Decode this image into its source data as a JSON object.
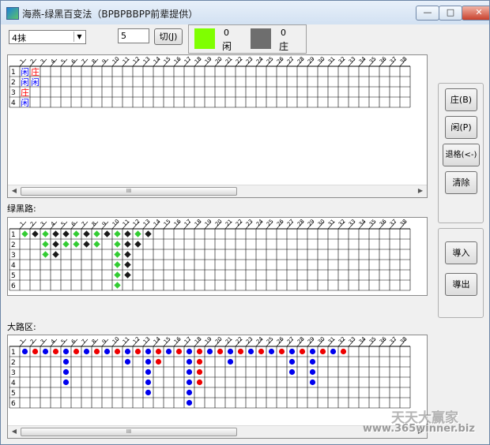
{
  "window": {
    "title": "海燕-绿黑百变法（BPBPBBPP前辈提供）",
    "buttons": {
      "minimize": "—",
      "maximize": "□",
      "close": "✕"
    }
  },
  "toolbar": {
    "pattern_select": "4抹",
    "count_value": "5",
    "cut_button": "切(J)",
    "player_count": "0",
    "player_label": "闲",
    "banker_count": "0",
    "banker_label": "庄"
  },
  "colors": {
    "player_swatch": "#7fff00",
    "banker_swatch": "#6e6e6e",
    "player_text": "#0000ff",
    "banker_text": "#ff0000",
    "green_mark": "#33cc33",
    "black_mark": "#1a1a1a",
    "blue_dot": "#0000ee",
    "red_dot": "#ee0000"
  },
  "top_grid": {
    "columns": [
      "1",
      "2",
      "3",
      "4",
      "5",
      "6",
      "7",
      "8",
      "9",
      "10",
      "11",
      "12",
      "13",
      "14",
      "15",
      "16",
      "17",
      "18",
      "19",
      "20",
      "21",
      "22",
      "23",
      "24",
      "25",
      "26",
      "27",
      "28",
      "29",
      "30",
      "31",
      "32",
      "33",
      "34",
      "35",
      "36",
      "37",
      "38"
    ],
    "rows": [
      "1",
      "2",
      "3",
      "4"
    ],
    "cells": [
      {
        "row": 0,
        "col": 0,
        "text": "闲",
        "color": "player"
      },
      {
        "row": 0,
        "col": 1,
        "text": "庄",
        "color": "banker"
      },
      {
        "row": 1,
        "col": 0,
        "text": "闲",
        "color": "player"
      },
      {
        "row": 1,
        "col": 1,
        "text": "闲",
        "color": "player"
      },
      {
        "row": 2,
        "col": 0,
        "text": "庄",
        "color": "banker"
      },
      {
        "row": 3,
        "col": 0,
        "text": "闲",
        "color": "player"
      }
    ],
    "scroll_thumb": "III"
  },
  "green_black_road": {
    "label": "绿黑路:",
    "rows": [
      "1",
      "2",
      "3",
      "4",
      "5",
      "6"
    ],
    "marks": [
      [
        0,
        0,
        "g"
      ],
      [
        0,
        1,
        "k"
      ],
      [
        0,
        2,
        "g"
      ],
      [
        0,
        3,
        "k"
      ],
      [
        0,
        4,
        "k"
      ],
      [
        0,
        5,
        "g"
      ],
      [
        0,
        6,
        "k"
      ],
      [
        0,
        7,
        "g"
      ],
      [
        0,
        8,
        "k"
      ],
      [
        0,
        9,
        "g"
      ],
      [
        0,
        10,
        "k"
      ],
      [
        0,
        11,
        "g"
      ],
      [
        0,
        12,
        "k"
      ],
      [
        1,
        2,
        "g"
      ],
      [
        1,
        3,
        "k"
      ],
      [
        1,
        4,
        "g"
      ],
      [
        1,
        5,
        "g"
      ],
      [
        1,
        6,
        "k"
      ],
      [
        1,
        7,
        "g"
      ],
      [
        1,
        9,
        "g"
      ],
      [
        1,
        10,
        "k"
      ],
      [
        1,
        11,
        "k"
      ],
      [
        2,
        2,
        "g"
      ],
      [
        2,
        3,
        "k"
      ],
      [
        2,
        9,
        "g"
      ],
      [
        2,
        10,
        "k"
      ],
      [
        3,
        9,
        "g"
      ],
      [
        3,
        10,
        "k"
      ],
      [
        4,
        9,
        "g"
      ],
      [
        4,
        10,
        "k"
      ],
      [
        5,
        9,
        "g"
      ]
    ]
  },
  "big_road": {
    "label": "大路区:",
    "rows": [
      "1",
      "2",
      "3",
      "4",
      "5",
      "6"
    ],
    "dots": [
      [
        0,
        0,
        "b"
      ],
      [
        0,
        1,
        "r"
      ],
      [
        0,
        2,
        "b"
      ],
      [
        0,
        3,
        "r"
      ],
      [
        0,
        4,
        "b"
      ],
      [
        0,
        5,
        "r"
      ],
      [
        0,
        6,
        "b"
      ],
      [
        0,
        7,
        "r"
      ],
      [
        0,
        8,
        "b"
      ],
      [
        0,
        9,
        "r"
      ],
      [
        0,
        10,
        "b"
      ],
      [
        0,
        11,
        "r"
      ],
      [
        0,
        12,
        "b"
      ],
      [
        0,
        13,
        "r"
      ],
      [
        0,
        14,
        "b"
      ],
      [
        0,
        15,
        "r"
      ],
      [
        0,
        16,
        "b"
      ],
      [
        0,
        17,
        "r"
      ],
      [
        0,
        18,
        "b"
      ],
      [
        0,
        19,
        "r"
      ],
      [
        0,
        20,
        "b"
      ],
      [
        0,
        21,
        "r"
      ],
      [
        0,
        22,
        "b"
      ],
      [
        0,
        23,
        "r"
      ],
      [
        0,
        24,
        "b"
      ],
      [
        0,
        25,
        "r"
      ],
      [
        0,
        26,
        "b"
      ],
      [
        0,
        27,
        "r"
      ],
      [
        0,
        28,
        "b"
      ],
      [
        0,
        29,
        "r"
      ],
      [
        0,
        30,
        "b"
      ],
      [
        0,
        31,
        "r"
      ],
      [
        1,
        4,
        "b"
      ],
      [
        1,
        10,
        "b"
      ],
      [
        1,
        12,
        "b"
      ],
      [
        1,
        13,
        "r"
      ],
      [
        1,
        16,
        "b"
      ],
      [
        1,
        17,
        "r"
      ],
      [
        1,
        20,
        "b"
      ],
      [
        1,
        26,
        "b"
      ],
      [
        1,
        28,
        "b"
      ],
      [
        2,
        4,
        "b"
      ],
      [
        2,
        12,
        "b"
      ],
      [
        2,
        16,
        "b"
      ],
      [
        2,
        17,
        "r"
      ],
      [
        2,
        26,
        "b"
      ],
      [
        2,
        28,
        "b"
      ],
      [
        3,
        4,
        "b"
      ],
      [
        3,
        12,
        "b"
      ],
      [
        3,
        16,
        "b"
      ],
      [
        3,
        17,
        "r"
      ],
      [
        3,
        28,
        "b"
      ],
      [
        4,
        12,
        "b"
      ],
      [
        4,
        16,
        "b"
      ],
      [
        5,
        16,
        "b"
      ]
    ]
  },
  "side_buttons": {
    "banker": "庄(B)",
    "player": "闲(P)",
    "back": "退格(<-)",
    "clear": "清除",
    "import": "導入",
    "export": "導出"
  },
  "watermark": {
    "line1": "天天大赢家",
    "line2": "www.365winner.biz"
  }
}
